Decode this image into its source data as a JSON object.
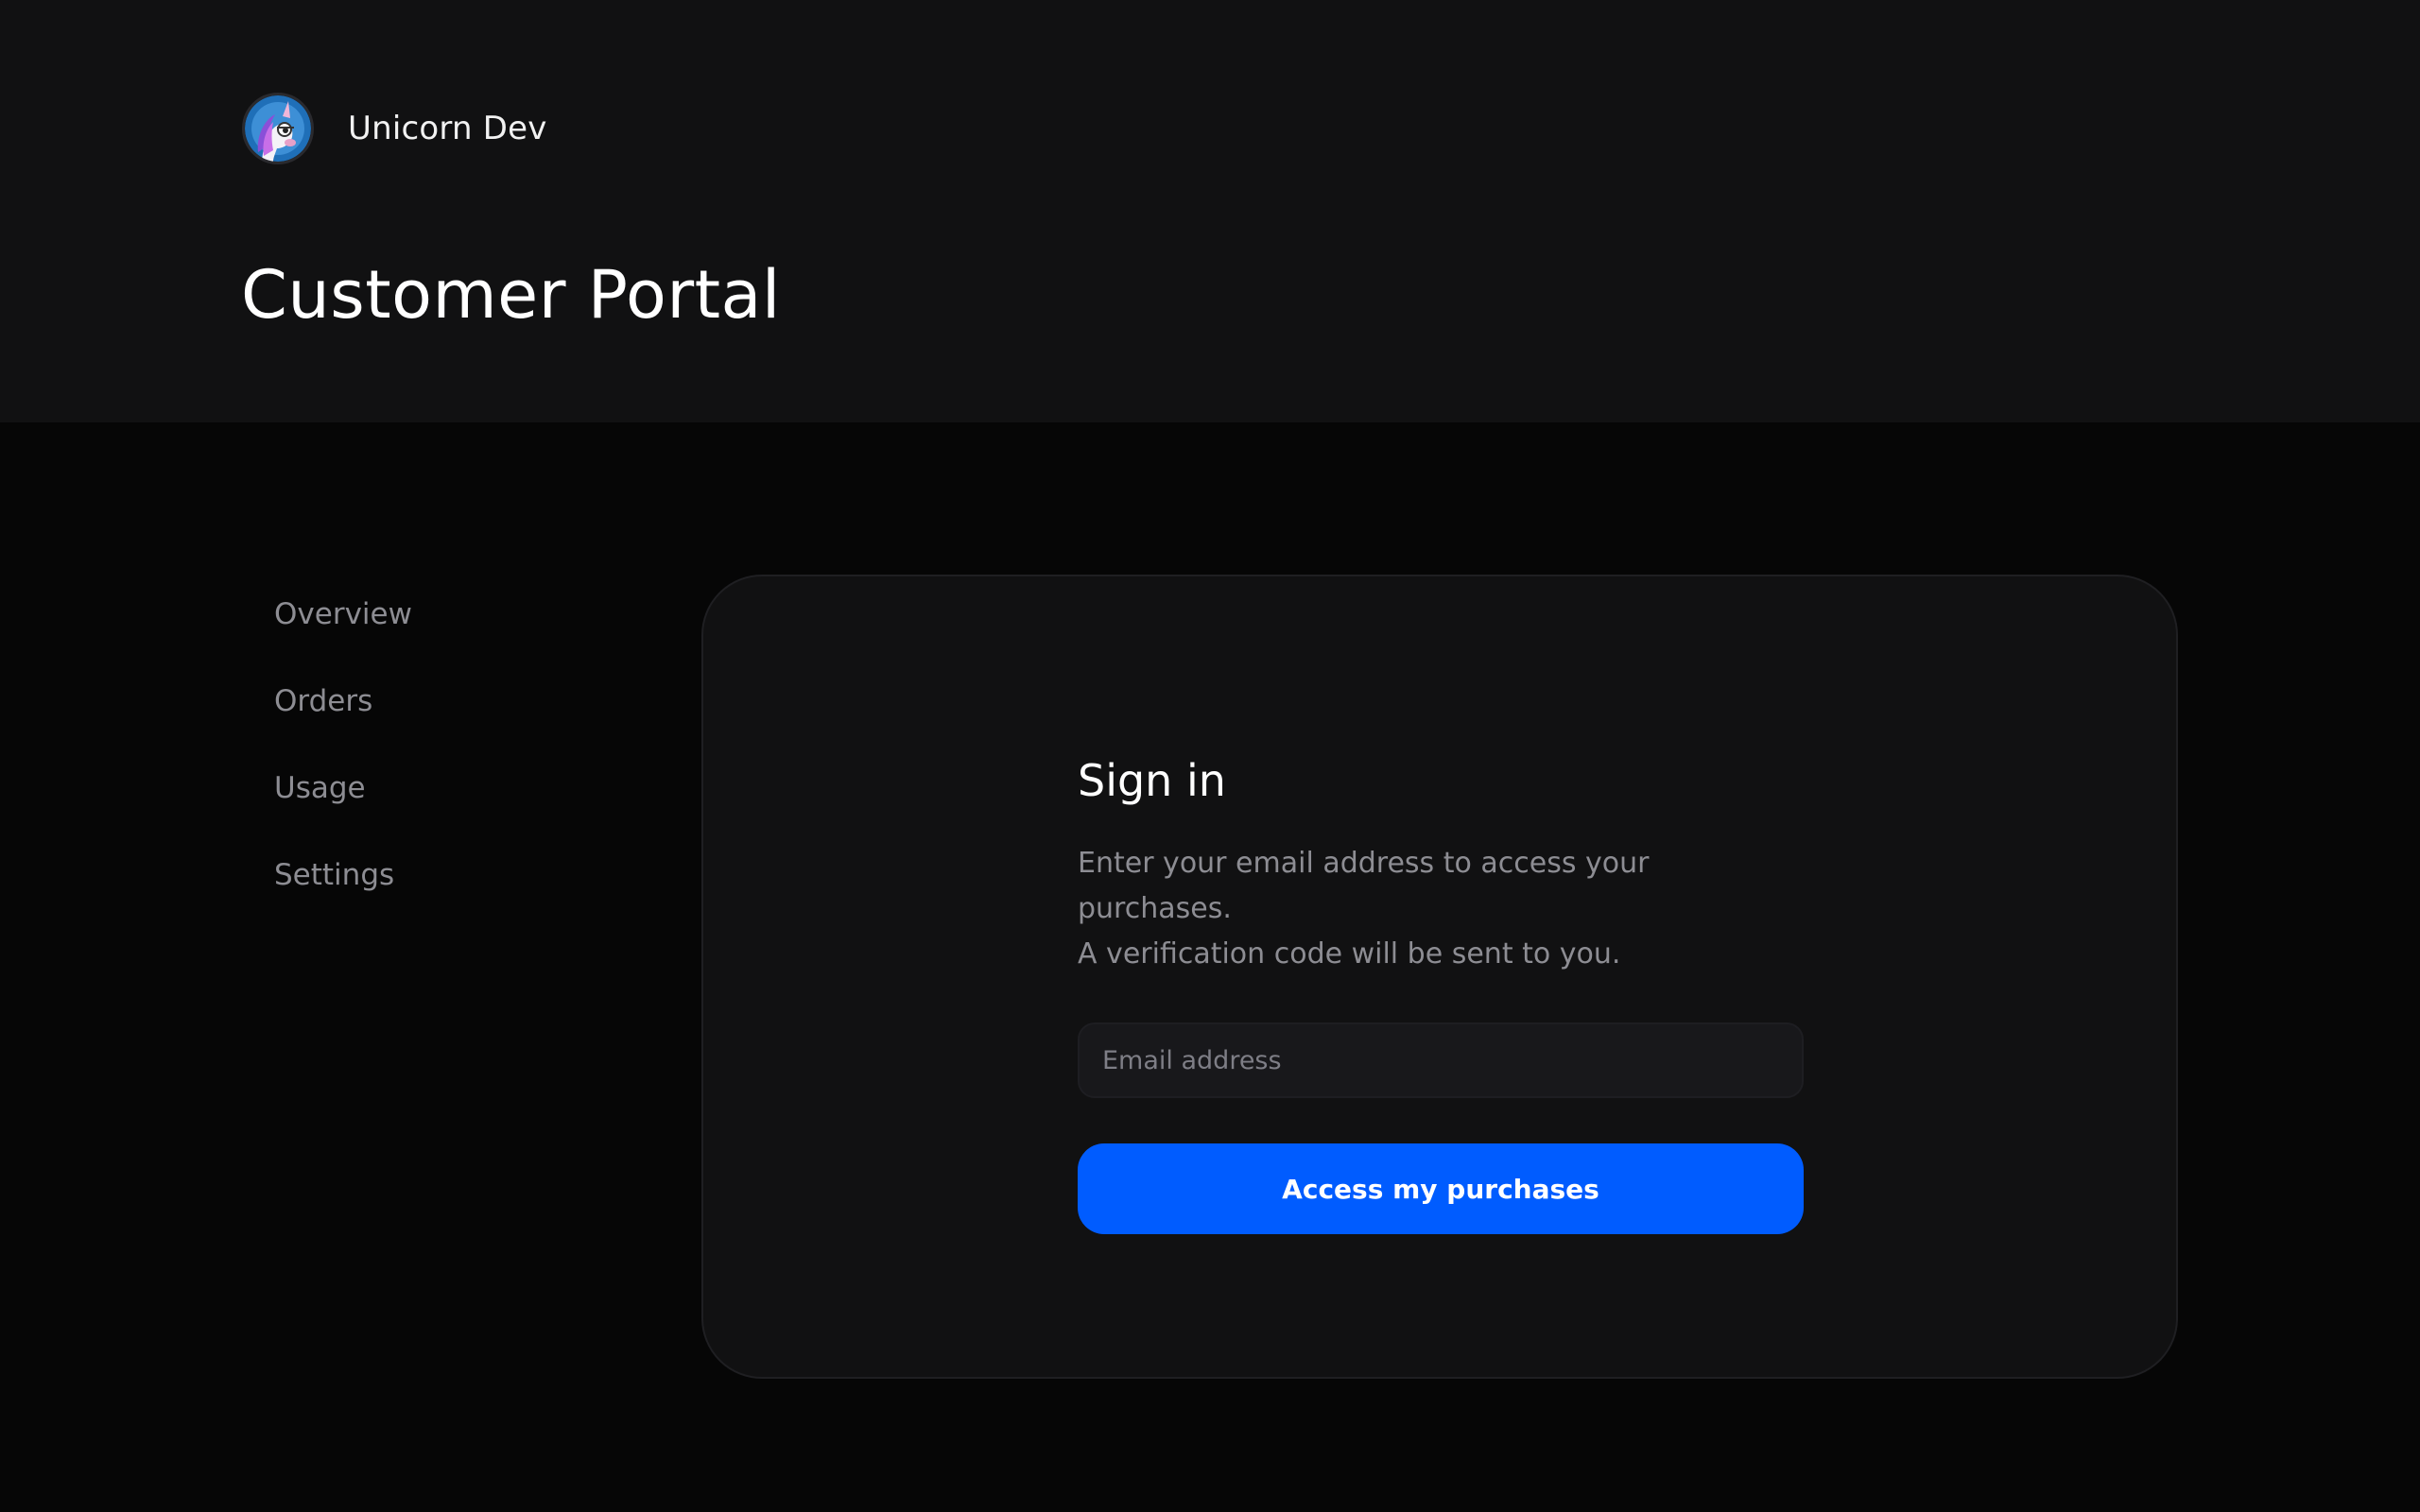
{
  "header": {
    "brand_name": "Unicorn Dev",
    "title": "Customer Portal",
    "avatar_icon": "unicorn-logo-icon"
  },
  "sidebar": {
    "items": [
      {
        "label": "Overview"
      },
      {
        "label": "Orders"
      },
      {
        "label": "Usage"
      },
      {
        "label": "Settings"
      }
    ]
  },
  "signin": {
    "title": "Sign in",
    "description_line1": "Enter your email address to access your purchases.",
    "description_line2": "A verification code will be sent to you.",
    "email_placeholder": "Email address",
    "email_value": "",
    "submit_label": "Access my purchases"
  },
  "colors": {
    "page_background": "#060606",
    "header_background": "#111112",
    "card_background": "#111112",
    "accent": "#005cff",
    "muted_text": "#8d8d93"
  }
}
